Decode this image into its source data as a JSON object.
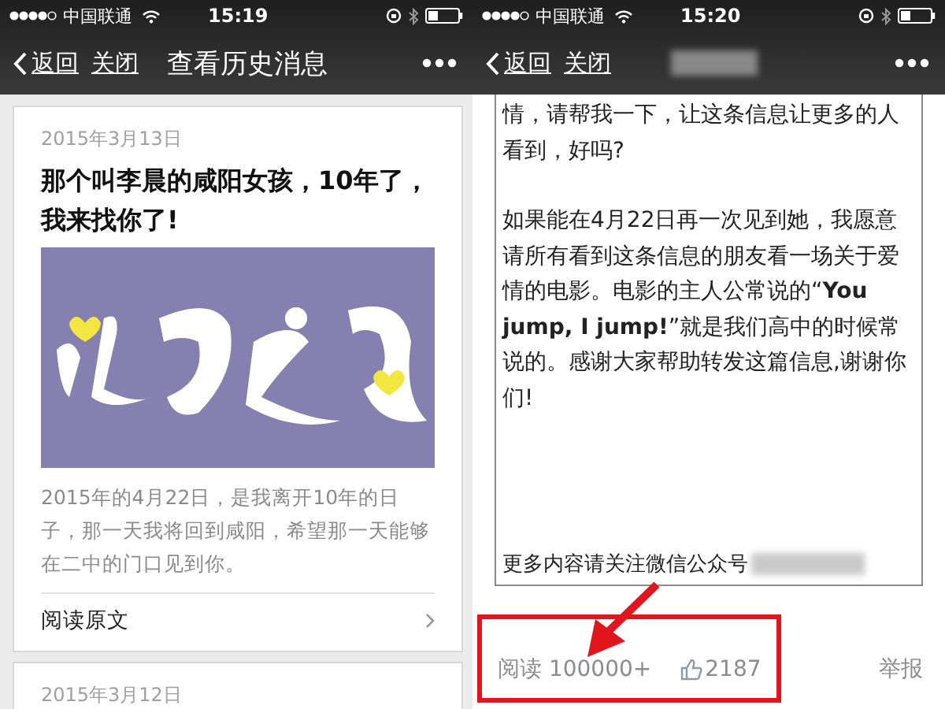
{
  "left_screen": {
    "status_bar": {
      "carrier": "中国联通",
      "time": "15:19"
    },
    "nav": {
      "back": "返回",
      "close": "关闭",
      "title": "查看历史消息"
    },
    "cards": [
      {
        "date": "2015年3月13日",
        "title": "那个叫李晨的咸阳女孩，10年了，我来找你了!",
        "summary": "2015年的4月22日，是我离开10年的日子，那一天我将回到咸阳，希望那一天能够在二中的门口见到你。",
        "link": "阅读原文"
      },
      {
        "date": "2015年3月12日"
      }
    ]
  },
  "right_screen": {
    "status_bar": {
      "carrier": "中国联通",
      "time": "15:20"
    },
    "nav": {
      "back": "返回",
      "close": "关闭"
    },
    "paragraphs": [
      "情，请帮我一下，让这条信息让更多的人看到，好吗?",
      "如果能在4月22日再一次见到她，我愿意请所有看到这条信息的朋友看一场关于爱情的电影。电影的主人公常说的“**You jump, I jump!**”就是我们高中的时候常说的。感谢大家帮助转发这篇信息,谢谢你们!"
    ],
    "follow_note": "更多内容请关注微信公众号",
    "footer": {
      "reads": "阅读 100000+",
      "likes": "2187",
      "report": "举报"
    }
  }
}
